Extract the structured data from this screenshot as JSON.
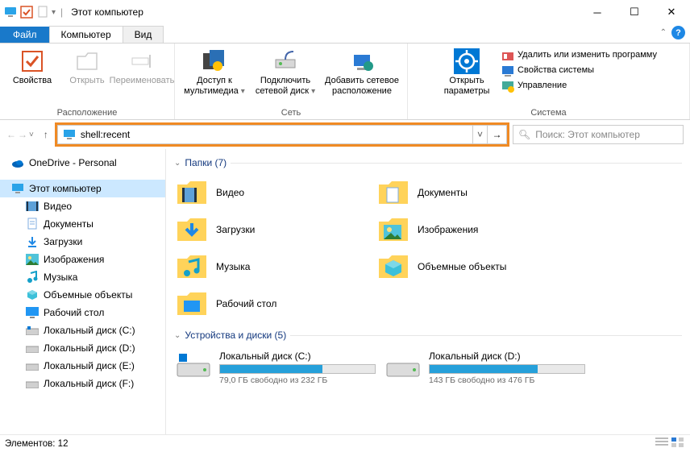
{
  "title": "Этот компьютер",
  "tabs": {
    "file": "Файл",
    "computer": "Компьютер",
    "view": "Вид"
  },
  "ribbon": {
    "loc_group": "Расположение",
    "props": "Свойства",
    "open": "Открыть",
    "rename": "Переименовать",
    "net_group": "Сеть",
    "media": "Доступ к мультимедиа",
    "netdrive": "Подключить сетевой диск",
    "netloc": "Добавить сетевое расположение",
    "sys_group": "Система",
    "params": "Открыть параметры",
    "s1": "Удалить или изменить программу",
    "s2": "Свойства системы",
    "s3": "Управление"
  },
  "address": {
    "value": "shell:recent",
    "search_ph": "Поиск: Этот компьютер"
  },
  "tree": {
    "onedrive": "OneDrive - Personal",
    "thispc": "Этот компьютер",
    "video": "Видео",
    "docs": "Документы",
    "downloads": "Загрузки",
    "images": "Изображения",
    "music": "Музыка",
    "obj3d": "Объемные объекты",
    "desktop": "Рабочий стол",
    "dc": "Локальный диск (C:)",
    "dd": "Локальный диск (D:)",
    "de": "Локальный диск (E:)",
    "df": "Локальный диск (F:)"
  },
  "sections": {
    "folders": "Папки (7)",
    "drives": "Устройства и диски (5)"
  },
  "folders": {
    "video": "Видео",
    "docs": "Документы",
    "downloads": "Загрузки",
    "images": "Изображения",
    "music": "Музыка",
    "obj3d": "Объемные объекты",
    "desktop": "Рабочий стол"
  },
  "drives": {
    "c": {
      "name": "Локальный диск (C:)",
      "free": "79,0 ГБ свободно из 232 ГБ",
      "fill": 66
    },
    "d": {
      "name": "Локальный диск (D:)",
      "free": "143 ГБ свободно из 476 ГБ",
      "fill": 70
    }
  },
  "status": "Элементов: 12"
}
